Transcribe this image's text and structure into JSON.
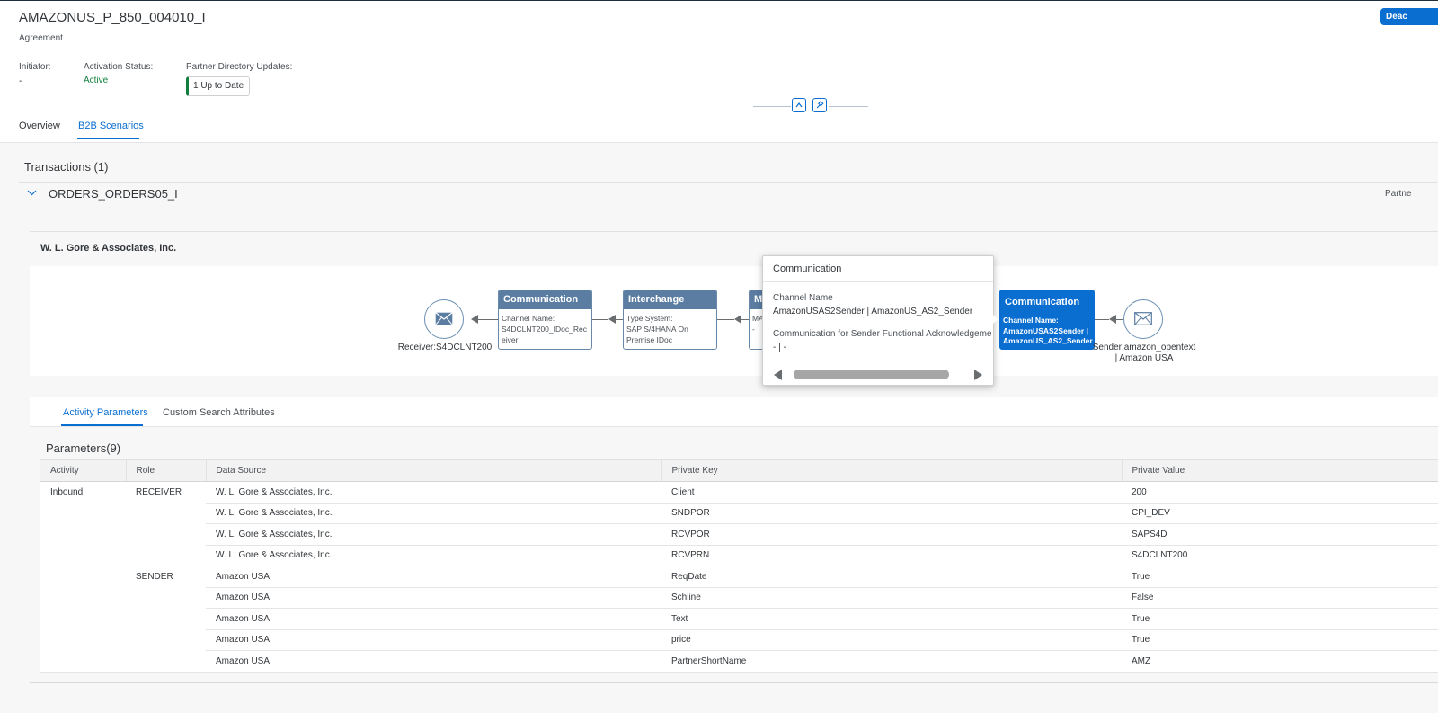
{
  "header": {
    "title": "AMAZONUS_P_850_004010_I",
    "subtitle": "Agreement",
    "deactivate_label": "Deac",
    "attributes": {
      "initiator_label": "Initiator:",
      "initiator_value": "-",
      "activation_label": "Activation Status:",
      "activation_value": "Active",
      "partner_updates_label": "Partner Directory Updates:",
      "partner_updates_badge": "1 Up to Date"
    },
    "tabs": [
      {
        "label": "Overview"
      },
      {
        "label": "B2B Scenarios",
        "active": true
      }
    ]
  },
  "transactions": {
    "title": "Transactions (1)",
    "item_name": "ORDERS_ORDERS05_I",
    "right_label": "Partne"
  },
  "flow": {
    "company": "W. L. Gore & Associates, Inc.",
    "receiver_label": "Receiver:S4DCLNT200",
    "sender_label_line1": "Sender:amazon_opentext",
    "sender_label_line2": "| Amazon USA",
    "box_comm_left": {
      "title": "Communication",
      "line1": "Channel Name:",
      "line2": "S4DCLNT200_IDoc_Rec",
      "line3": "eiver"
    },
    "box_interchange": {
      "title": "Interchange",
      "line1": "Type System:",
      "line2": "SAP S/4HANA On",
      "line3": "Premise IDoc"
    },
    "box_mapping": {
      "title": "M",
      "line1": "MA",
      "line2": "-"
    },
    "box_comm_right": {
      "title": "Communication",
      "line1": "Channel Name:",
      "line2": "AmazonUSAS2Sender |",
      "line3": "AmazonUS_AS2_Sender"
    }
  },
  "popover": {
    "title": "Communication",
    "channel_label": "Channel Name",
    "channel_value": "AmazonUSAS2Sender | AmazonUS_AS2_Sender",
    "ack_label": "Communication for Sender Functional Acknowledgeme",
    "ack_value": "- | -"
  },
  "activity_tabs": [
    {
      "label": "Activity Parameters",
      "active": true
    },
    {
      "label": "Custom Search Attributes"
    }
  ],
  "parameters": {
    "title": "Parameters(9)",
    "columns": [
      "Activity",
      "Role",
      "Data Source",
      "Private Key",
      "Private Value"
    ],
    "rows": [
      [
        "Inbound",
        "RECEIVER",
        "W. L. Gore & Associates, Inc.",
        "Client",
        "200"
      ],
      [
        "",
        "",
        "W. L. Gore & Associates, Inc.",
        "SNDPOR",
        "CPI_DEV"
      ],
      [
        "",
        "",
        "W. L. Gore & Associates, Inc.",
        "RCVPOR",
        "SAPS4D"
      ],
      [
        "",
        "",
        "W. L. Gore & Associates, Inc.",
        "RCVPRN",
        "S4DCLNT200"
      ],
      [
        "",
        "SENDER",
        "Amazon USA",
        "ReqDate",
        "True"
      ],
      [
        "",
        "",
        "Amazon USA",
        "Schline",
        "False"
      ],
      [
        "",
        "",
        "Amazon USA",
        "Text",
        "True"
      ],
      [
        "",
        "",
        "Amazon USA",
        "price",
        "True"
      ],
      [
        "",
        "",
        "Amazon USA",
        "PartnerShortName",
        "AMZ"
      ]
    ]
  },
  "colors": {
    "accent": "#0a6ed1",
    "active_status": "#107e3e",
    "node_header": "#5b7da2"
  },
  "icons": [
    "envelope-icon",
    "chevron-down-icon",
    "collapse-up-icon",
    "pin-icon",
    "scroll-left-icon",
    "scroll-right-icon"
  ]
}
